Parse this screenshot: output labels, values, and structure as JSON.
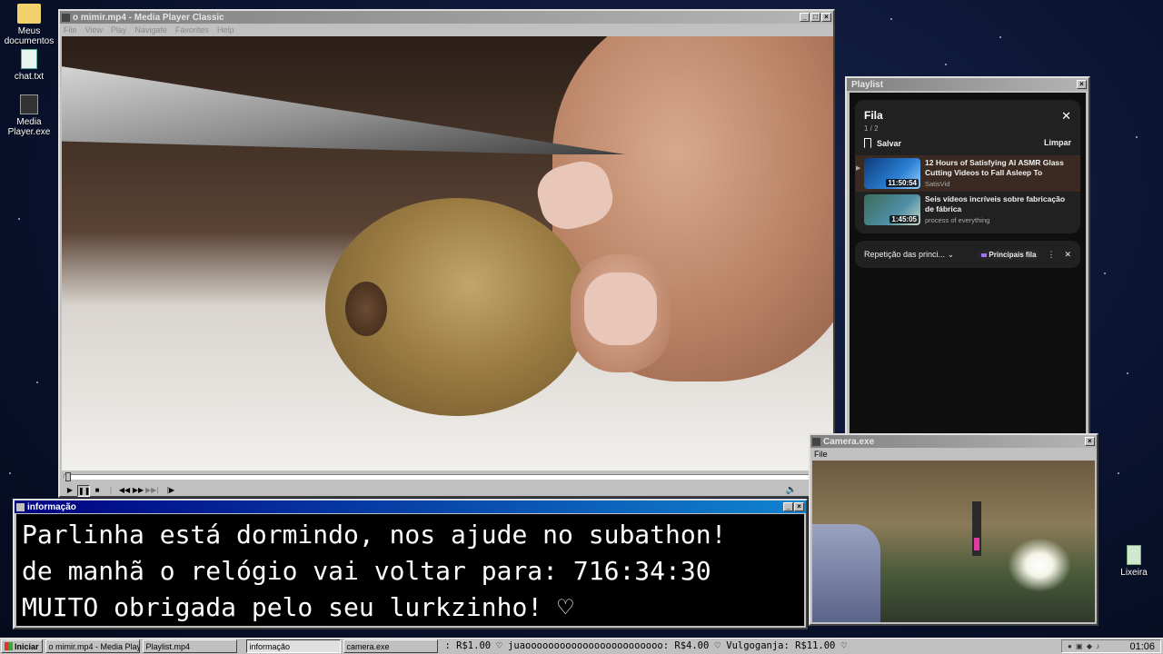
{
  "desktop": {
    "icons": [
      {
        "label": "Meus documentos",
        "icon": "folder-icon"
      },
      {
        "label": "chat.txt",
        "icon": "text-file-icon"
      },
      {
        "label": "Media Player.exe",
        "icon": "media-player-icon"
      },
      {
        "label": "Lixeira",
        "icon": "recycle-bin-icon"
      }
    ]
  },
  "media_player": {
    "title": "o mimir.mp4 - Media Player Classic",
    "menu": [
      "File",
      "View",
      "Play",
      "Navigate",
      "Favorites",
      "Help"
    ],
    "controls": [
      "play",
      "pause",
      "stop",
      "prev",
      "rewind",
      "forward",
      "next",
      "frame-step"
    ]
  },
  "playlist": {
    "window_title": "Playlist",
    "heading": "Fila",
    "count": "1 / 2",
    "save_label": "Salvar",
    "clear_label": "Limpar",
    "items": [
      {
        "title": "12 Hours of Satisfying AI ASMR Glass Cutting Videos to Fall Asleep To",
        "channel": "SatisVid",
        "duration": "11:50:54",
        "current": true,
        "thumb_color": "#2a7fd4"
      },
      {
        "title": "Seis vídeos incríveis sobre fabricação de fábrica",
        "channel": "process of everything",
        "duration": "1:45:05",
        "current": false,
        "thumb_color": "#4f8fa6"
      }
    ],
    "loop_label": "Repetição das princi...",
    "pill_label": "Principais fila"
  },
  "camera": {
    "title": "Camera.exe",
    "menu": [
      "File"
    ]
  },
  "info": {
    "title": "informação",
    "lines": [
      "Parlinha está dormindo, nos ajude no subathon!",
      "de manhã o relógio vai voltar para:  716:34:30",
      "MUITO obrigada pelo seu lurkzinho! ♡"
    ]
  },
  "taskbar": {
    "start_label": "Iniciar",
    "tasks": [
      {
        "label": "o mimir.mp4 - Media Playe...",
        "active": false
      },
      {
        "label": "Playlist.mp4",
        "active": false
      },
      {
        "label": "informação",
        "active": true
      },
      {
        "label": "camera.exe",
        "active": false
      }
    ],
    "ticker": ":  R$1.00  ♡  juaoooooooooooooooooooooooo:  R$4.00  ♡  Vulgoganja:  R$11.00  ♡",
    "clock": "01:06"
  },
  "colors": {
    "title_active": "#000080",
    "title_inactive": "#808080",
    "window_face": "#c0c0c0"
  }
}
